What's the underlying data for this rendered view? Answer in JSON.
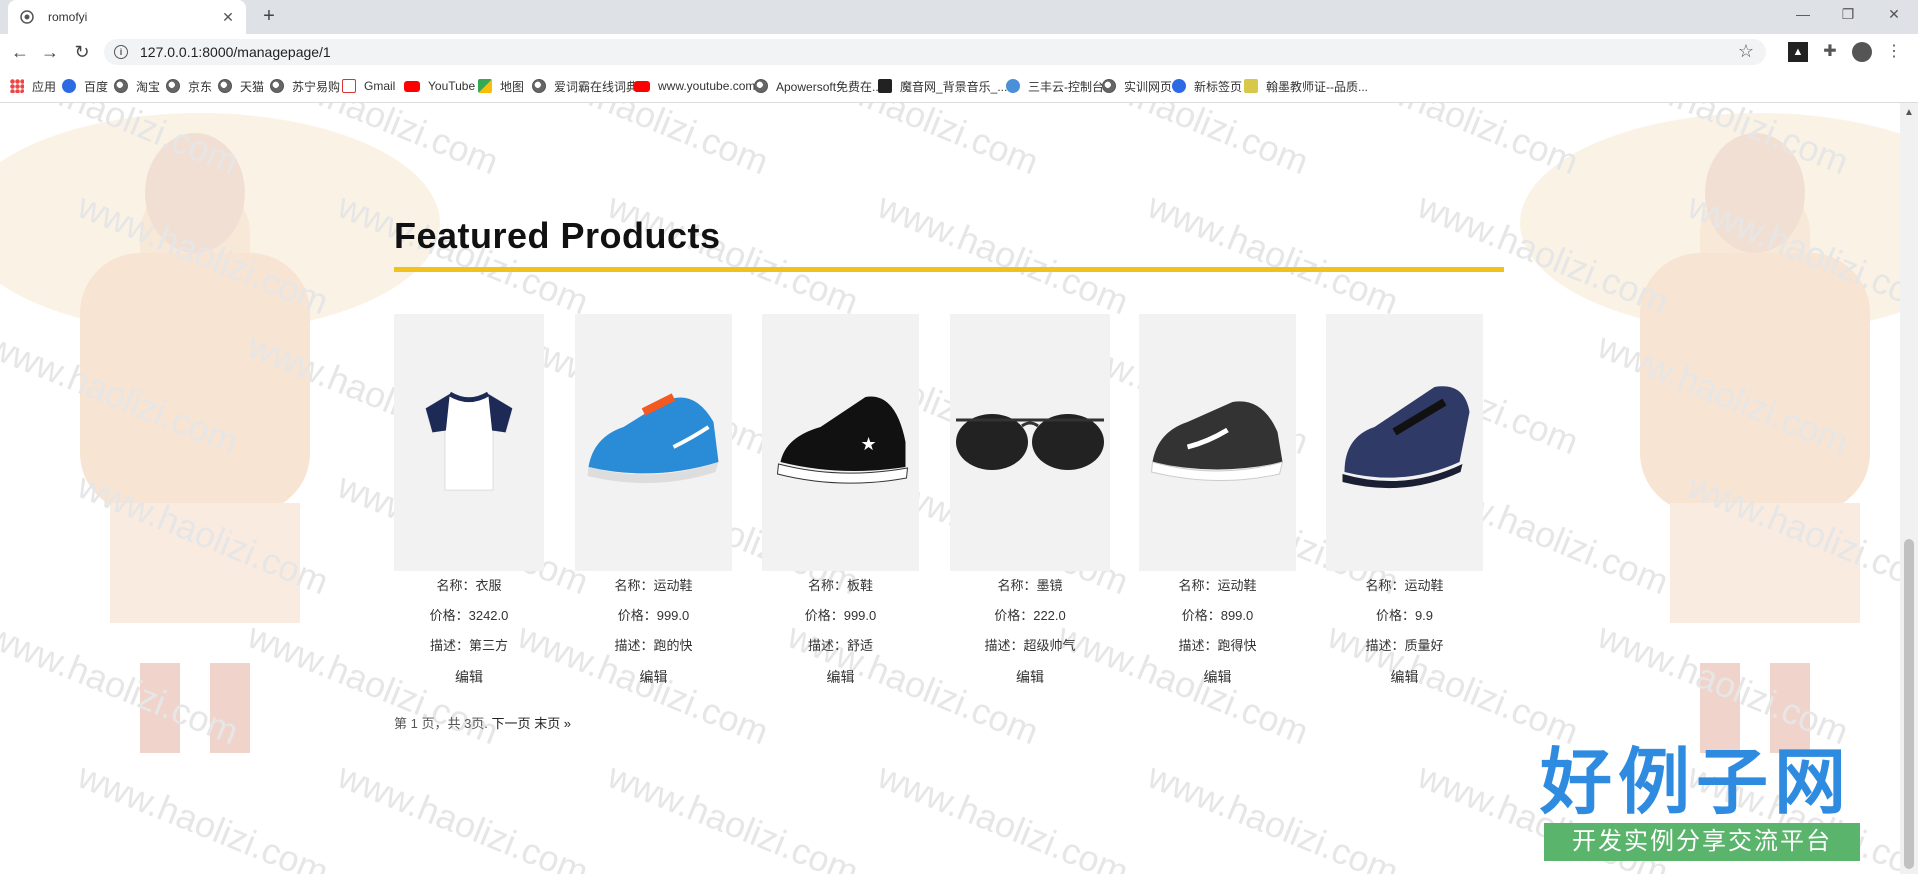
{
  "browser": {
    "tab_title": "romofyi",
    "url": "127.0.0.1:8000/managepage/1",
    "bookmarks": [
      {
        "label": "应用",
        "icon": "apps-icon"
      },
      {
        "label": "百度",
        "icon": "baidu-paw-icon"
      },
      {
        "label": "淘宝",
        "icon": "globe-icon"
      },
      {
        "label": "京东",
        "icon": "globe-icon"
      },
      {
        "label": "天猫",
        "icon": "globe-icon"
      },
      {
        "label": "苏宁易购",
        "icon": "globe-icon"
      },
      {
        "label": "Gmail",
        "icon": "gmail-icon"
      },
      {
        "label": "YouTube",
        "icon": "youtube-icon"
      },
      {
        "label": "地图",
        "icon": "maps-icon"
      },
      {
        "label": "爱词霸在线词典",
        "icon": "globe-icon"
      },
      {
        "label": "www.youtube.com",
        "icon": "youtube-icon"
      },
      {
        "label": "Apowersoft免费在...",
        "icon": "globe-icon"
      },
      {
        "label": "魔音网_背景音乐_...",
        "icon": "music-icon"
      },
      {
        "label": "三丰云-控制台",
        "icon": "cloud-icon"
      },
      {
        "label": "实训网页",
        "icon": "globe-icon"
      },
      {
        "label": "新标签页",
        "icon": "baidu-paw-icon"
      },
      {
        "label": "翰墨教师证--品质...",
        "icon": "h-icon"
      }
    ]
  },
  "page": {
    "section_title": "Featured Products",
    "accent_color": "#f1c21b",
    "products": [
      {
        "name": "名称：衣服",
        "price": "价格：3242.0",
        "desc": "描述：第三方",
        "edit": "编辑",
        "image": "tshirt"
      },
      {
        "name": "名称：运动鞋",
        "price": "价格：999.0",
        "desc": "描述：跑的快",
        "edit": "编辑",
        "image": "blue-sneaker"
      },
      {
        "name": "名称：板鞋",
        "price": "价格：999.0",
        "desc": "描述：舒适",
        "edit": "编辑",
        "image": "canvas-shoe"
      },
      {
        "name": "名称：墨镜",
        "price": "价格：222.0",
        "desc": "描述：超级帅气",
        "edit": "编辑",
        "image": "sunglasses"
      },
      {
        "name": "名称：运动鞋",
        "price": "价格：899.0",
        "desc": "描述：跑得快",
        "edit": "编辑",
        "image": "black-sneaker"
      },
      {
        "name": "名称：运动鞋",
        "price": "价格：9.9",
        "desc": "描述：质量好",
        "edit": "编辑",
        "image": "leather-shoe"
      }
    ],
    "pagination": {
      "info": "第 1 页，共 3页.",
      "next": "下一页",
      "last": "末页 »"
    }
  },
  "watermark": {
    "text": "www.haolizi.com",
    "brand_main": "好例子网",
    "brand_sub": "开发实例分享交流平台"
  }
}
